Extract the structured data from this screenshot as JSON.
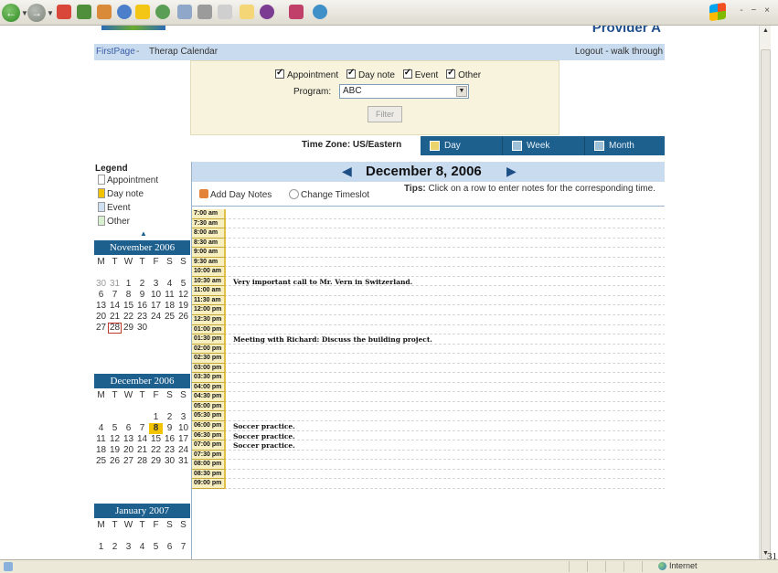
{
  "page": {
    "provider": "Provider A",
    "nav": {
      "first_page": "FirstPage",
      "separator": "-",
      "current": "Therap Calendar",
      "logout": "Logout - walk through"
    },
    "filters": [
      {
        "label": "Appointment",
        "checked": true
      },
      {
        "label": "Day note",
        "checked": true
      },
      {
        "label": "Event",
        "checked": true
      },
      {
        "label": "Other",
        "checked": true
      }
    ],
    "program_label": "Program:",
    "program_value": "ABC",
    "filter_button": "Filter",
    "timezone": "Time Zone: US/Eastern",
    "tabs": {
      "day": "Day",
      "week": "Week",
      "month": "Month"
    },
    "legend": {
      "title": "Legend",
      "items": [
        {
          "label": "Appointment",
          "color": "#ffffff"
        },
        {
          "label": "Day note",
          "color": "#f2c300"
        },
        {
          "label": "Event",
          "color": "#cfe0f3"
        },
        {
          "label": "Other",
          "color": "#d8f0d0"
        }
      ]
    },
    "calendars": [
      {
        "title": "November 2006",
        "weekdays": [
          "M",
          "T",
          "W",
          "T",
          "F",
          "S",
          "S"
        ],
        "days": [
          [
            "30",
            "dim"
          ],
          [
            "31",
            "dim"
          ],
          [
            "1",
            ""
          ],
          [
            "2",
            ""
          ],
          [
            "3",
            ""
          ],
          [
            "4",
            ""
          ],
          [
            "5",
            ""
          ],
          [
            "6",
            ""
          ],
          [
            "7",
            ""
          ],
          [
            "8",
            ""
          ],
          [
            "9",
            ""
          ],
          [
            "10",
            ""
          ],
          [
            "11",
            ""
          ],
          [
            "12",
            ""
          ],
          [
            "13",
            ""
          ],
          [
            "14",
            ""
          ],
          [
            "15",
            ""
          ],
          [
            "16",
            ""
          ],
          [
            "17",
            ""
          ],
          [
            "18",
            ""
          ],
          [
            "19",
            ""
          ],
          [
            "20",
            ""
          ],
          [
            "21",
            ""
          ],
          [
            "22",
            ""
          ],
          [
            "23",
            ""
          ],
          [
            "24",
            ""
          ],
          [
            "25",
            ""
          ],
          [
            "26",
            ""
          ],
          [
            "27",
            ""
          ],
          [
            "28",
            "sel"
          ],
          [
            "29",
            ""
          ],
          [
            "30",
            ""
          ]
        ]
      },
      {
        "title": "December 2006",
        "weekdays": [
          "M",
          "T",
          "W",
          "T",
          "F",
          "S",
          "S"
        ],
        "days": [
          [
            "",
            ""
          ],
          [
            "",
            ""
          ],
          [
            "",
            ""
          ],
          [
            "",
            ""
          ],
          [
            "1",
            ""
          ],
          [
            "2",
            ""
          ],
          [
            "3",
            ""
          ],
          [
            "4",
            ""
          ],
          [
            "5",
            ""
          ],
          [
            "6",
            ""
          ],
          [
            "7",
            ""
          ],
          [
            "8",
            "today"
          ],
          [
            "9",
            ""
          ],
          [
            "10",
            ""
          ],
          [
            "11",
            ""
          ],
          [
            "12",
            ""
          ],
          [
            "13",
            ""
          ],
          [
            "14",
            ""
          ],
          [
            "15",
            ""
          ],
          [
            "16",
            ""
          ],
          [
            "17",
            ""
          ],
          [
            "18",
            ""
          ],
          [
            "19",
            ""
          ],
          [
            "20",
            ""
          ],
          [
            "21",
            ""
          ],
          [
            "22",
            ""
          ],
          [
            "23",
            ""
          ],
          [
            "24",
            ""
          ],
          [
            "25",
            ""
          ],
          [
            "26",
            ""
          ],
          [
            "27",
            ""
          ],
          [
            "28",
            ""
          ],
          [
            "29",
            ""
          ],
          [
            "30",
            ""
          ],
          [
            "31",
            ""
          ]
        ]
      },
      {
        "title": "January 2007",
        "weekdays": [
          "M",
          "T",
          "W",
          "T",
          "F",
          "S",
          "S"
        ],
        "days": [
          [
            "1",
            ""
          ],
          [
            "2",
            ""
          ],
          [
            "3",
            ""
          ],
          [
            "4",
            ""
          ],
          [
            "5",
            ""
          ],
          [
            "6",
            ""
          ],
          [
            "7",
            ""
          ]
        ]
      }
    ],
    "date_title": "December 8, 2006",
    "add_notes": "Add Day Notes",
    "change_timeslot": "Change Timeslot",
    "tips_label": "Tips:",
    "tips_text": "Click on a row to enter notes for the corresponding time.",
    "slots": [
      {
        "time": "7:00 am",
        "note": ""
      },
      {
        "time": "7:30 am",
        "note": ""
      },
      {
        "time": "8:00 am",
        "note": ""
      },
      {
        "time": "8:30 am",
        "note": ""
      },
      {
        "time": "9:00 am",
        "note": ""
      },
      {
        "time": "9:30 am",
        "note": ""
      },
      {
        "time": "10:00 am",
        "note": ""
      },
      {
        "time": "10:30 am",
        "note": "Very important call to Mr. Vern in Switzerland."
      },
      {
        "time": "11:00 am",
        "note": ""
      },
      {
        "time": "11:30 am",
        "note": ""
      },
      {
        "time": "12:00 pm",
        "note": ""
      },
      {
        "time": "12:30 pm",
        "note": ""
      },
      {
        "time": "01:00 pm",
        "note": ""
      },
      {
        "time": "01:30 pm",
        "note": "Meeting with Richard: Discuss the building project."
      },
      {
        "time": "02:00 pm",
        "note": ""
      },
      {
        "time": "02:30 pm",
        "note": ""
      },
      {
        "time": "03:00 pm",
        "note": ""
      },
      {
        "time": "03:30 pm",
        "note": ""
      },
      {
        "time": "04:00 pm",
        "note": ""
      },
      {
        "time": "04:30 pm",
        "note": ""
      },
      {
        "time": "05:00 pm",
        "note": ""
      },
      {
        "time": "05:30 pm",
        "note": ""
      },
      {
        "time": "06:00 pm",
        "note": "Soccer practice."
      },
      {
        "time": "06:30 pm",
        "note": "Soccer practice."
      },
      {
        "time": "07:00 pm",
        "note": "Soccer practice."
      },
      {
        "time": "07:30 pm",
        "note": ""
      },
      {
        "time": "08:00 pm",
        "note": ""
      },
      {
        "time": "08:30 pm",
        "note": ""
      },
      {
        "time": "09:00 pm",
        "note": ""
      }
    ]
  },
  "statusbar": {
    "zone": "Internet"
  },
  "page_number": "31"
}
